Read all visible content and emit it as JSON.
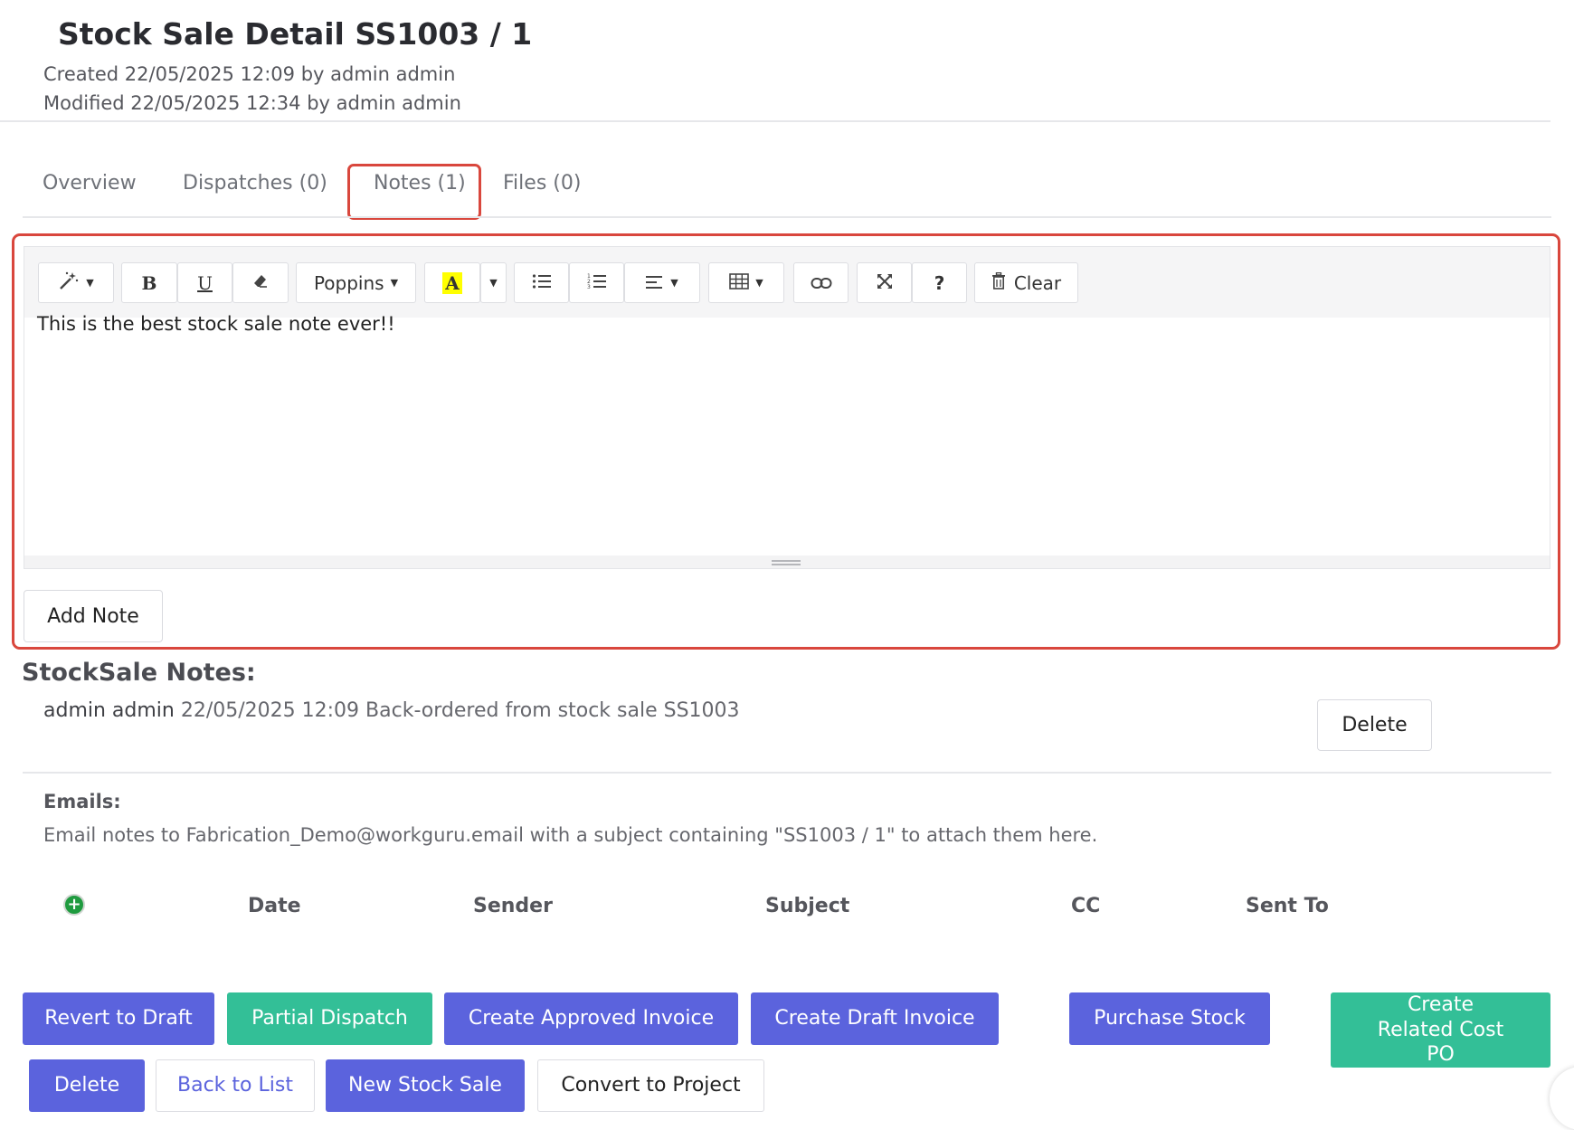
{
  "header": {
    "title": "Stock Sale Detail SS1003 / 1",
    "created": "Created 22/05/2025 12:09 by admin admin",
    "modified": "Modified 22/05/2025 12:34 by admin admin"
  },
  "tabs": [
    {
      "label": "Overview"
    },
    {
      "label": "Dispatches (0)"
    },
    {
      "label": "Notes (1)",
      "active": true
    },
    {
      "label": "Files (0)"
    }
  ],
  "editor": {
    "font_label": "Poppins",
    "bold_label": "B",
    "underline_label": "U",
    "highlight_label": "A",
    "help_label": "?",
    "clear_label": "Clear",
    "content": "This is the best stock sale note ever!!",
    "add_note_label": "Add Note"
  },
  "notes": {
    "heading": "StockSale Notes:",
    "items": [
      {
        "author": "admin admin",
        "text": "22/05/2025 12:09 Back-ordered from stock sale SS1003",
        "delete_label": "Delete"
      }
    ]
  },
  "emails": {
    "label": "Emails:",
    "instruction": "Email notes to Fabrication_Demo@workguru.email with a subject containing \"SS1003 / 1\" to attach them here.",
    "columns": [
      "Date",
      "Sender",
      "Subject",
      "CC",
      "Sent To"
    ],
    "add_label": "+"
  },
  "actions": {
    "revert_to_draft": "Revert to Draft",
    "partial_dispatch": "Partial Dispatch",
    "create_approved_invoice": "Create Approved Invoice",
    "create_draft_invoice": "Create Draft Invoice",
    "purchase_stock": "Purchase Stock",
    "create_related_cost_po": "Create Related Cost PO",
    "delete": "Delete",
    "back_to_list": "Back to List",
    "new_stock_sale": "New Stock Sale",
    "convert_to_project": "Convert to Project"
  },
  "colors": {
    "primary": "#5b63dd",
    "success": "#33bf97",
    "highlight": "#d9473d"
  }
}
